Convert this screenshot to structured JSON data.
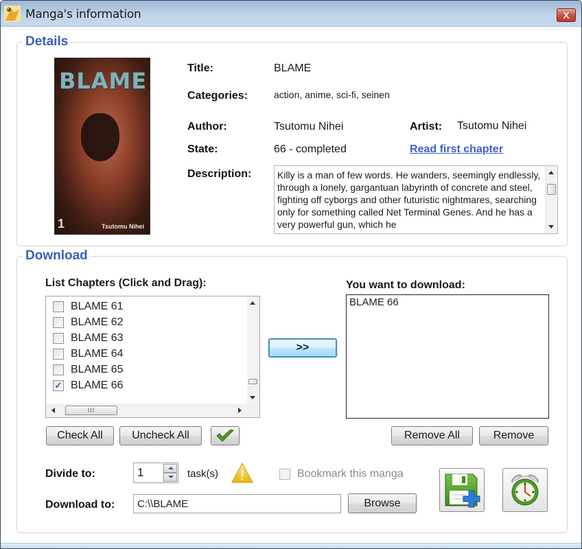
{
  "window": {
    "title": "Manga's information",
    "close_label": "X"
  },
  "details": {
    "group_title": "Details",
    "cover": {
      "title_art": "BLAME!",
      "volume": "1",
      "author_art": "Tsutomu Nihei"
    },
    "title_label": "Title:",
    "title_value": "BLAME",
    "categories_label": "Categories:",
    "categories_value": "action, anime, sci-fi, seinen",
    "author_label": "Author:",
    "author_value": "Tsutomu Nihei",
    "artist_label": "Artist:",
    "artist_value": "Tsutomu Nihei",
    "state_label": "State:",
    "state_value": "66 - completed",
    "read_link": "Read first chapter",
    "description_label": "Description:",
    "description_value": "Killy is a man of few words. He wanders, seemingly endlessly, through a lonely, gargantuan labyrinth of concrete and steel, fighting off cyborgs and other futuristic nightmares, searching only for something called Net Terminal Genes. And he has a very powerful gun, which he"
  },
  "download": {
    "group_title": "Download",
    "list_label": "List Chapters (Click and Drag):",
    "chapters": [
      {
        "label": "BLAME 61",
        "checked": false
      },
      {
        "label": "BLAME 62",
        "checked": false
      },
      {
        "label": "BLAME 63",
        "checked": false
      },
      {
        "label": "BLAME 64",
        "checked": false
      },
      {
        "label": "BLAME 65",
        "checked": false
      },
      {
        "label": "BLAME 66",
        "checked": true
      }
    ],
    "hscroll_grip": "III",
    "move_button": ">>",
    "want_label": "You want to download:",
    "want_items": [
      "BLAME 66"
    ],
    "check_all": "Check All",
    "uncheck_all": "Uncheck All",
    "remove_all": "Remove All",
    "remove": "Remove",
    "divide_label": "Divide to:",
    "divide_value": "1",
    "tasks_label": "task(s)",
    "bookmark_label": "Bookmark this manga",
    "bookmark_checked": false,
    "download_to_label": "Download to:",
    "download_path": "C:\\\\BLAME",
    "browse": "Browse"
  },
  "colors": {
    "group_title": "#3b5fb8",
    "link": "#3a5fcf",
    "focus_border": "#4a93c2"
  }
}
